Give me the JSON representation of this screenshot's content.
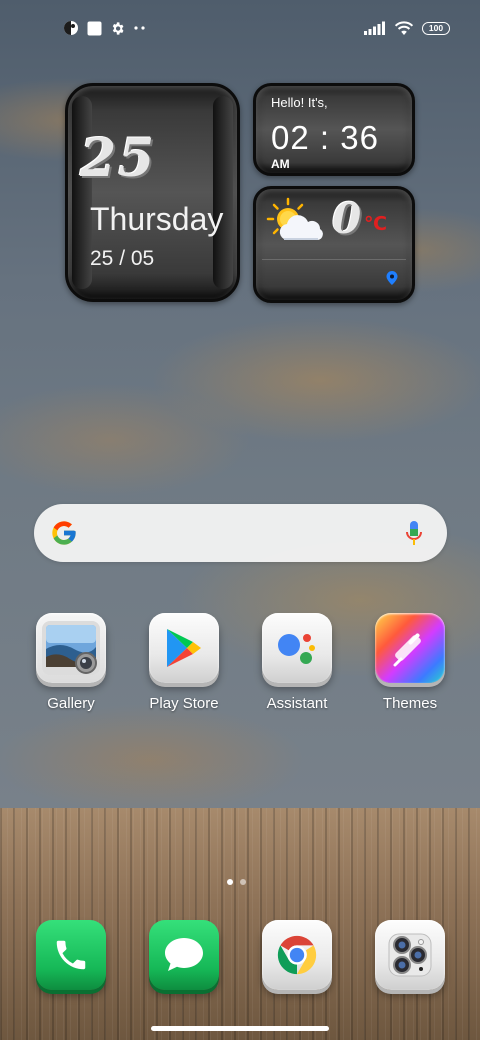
{
  "status_bar": {
    "left_icons": [
      "app-notification-icon",
      "square-notification-icon",
      "gear-icon",
      "more-dots-icon"
    ],
    "right_icons": [
      "signal-icon",
      "wifi-icon",
      "battery-icon"
    ],
    "battery_level": "100"
  },
  "date_widget": {
    "day_number": "25",
    "weekday": "Thursday",
    "date_short": "25 / 05"
  },
  "clock_widget": {
    "greeting": "Hello! It's,",
    "time": "02 : 36",
    "period": "AM"
  },
  "weather_widget": {
    "icon": "sun-behind-cloud-icon",
    "temperature": "0",
    "unit": "℃",
    "unit_color": "#e02020",
    "location_icon": "location-pin-icon"
  },
  "search": {
    "logo": "google-g-icon",
    "mic": "microphone-icon"
  },
  "apps": [
    {
      "label": "Gallery",
      "icon": "gallery-icon"
    },
    {
      "label": "Play Store",
      "icon": "play-store-icon"
    },
    {
      "label": "Assistant",
      "icon": "assistant-icon"
    },
    {
      "label": "Themes",
      "icon": "themes-icon"
    }
  ],
  "dock": [
    {
      "name": "phone",
      "icon": "phone-icon"
    },
    {
      "name": "messages",
      "icon": "message-bubble-icon"
    },
    {
      "name": "chrome",
      "icon": "chrome-icon"
    },
    {
      "name": "camera",
      "icon": "camera-icon"
    }
  ],
  "pager": {
    "pages": 2,
    "active": 0
  }
}
